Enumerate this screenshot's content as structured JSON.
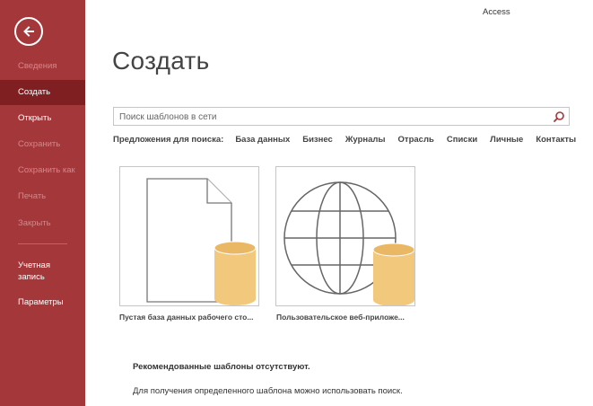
{
  "app": {
    "name": "Access"
  },
  "colors": {
    "sidebar": "#a4373a",
    "sidebar_active": "#7f1f22",
    "db_yellow": "#f2c97c"
  },
  "sidebar": {
    "back_icon": "back-arrow-icon",
    "items": [
      {
        "label": "Сведения",
        "state": "disabled"
      },
      {
        "label": "Создать",
        "state": "active"
      },
      {
        "label": "Открыть",
        "state": "enabled"
      },
      {
        "label": "Сохранить",
        "state": "disabled"
      },
      {
        "label": "Сохранить как",
        "state": "disabled"
      },
      {
        "label": "Печать",
        "state": "disabled"
      },
      {
        "label": "Закрыть",
        "state": "disabled"
      }
    ],
    "bottom_items": [
      {
        "label_line1": "Учетная",
        "label_line2": "запись"
      },
      {
        "label": "Параметры"
      }
    ]
  },
  "main": {
    "title": "Создать",
    "search": {
      "placeholder": "Поиск шаблонов в сети",
      "value": ""
    },
    "suggestions": {
      "label": "Предложения для поиска:",
      "links": [
        "База данных",
        "Бизнес",
        "Журналы",
        "Отрасль",
        "Списки",
        "Личные",
        "Контакты"
      ]
    },
    "templates": [
      {
        "label": "Пустая база данных рабочего сто...",
        "icon": "blank-database-icon"
      },
      {
        "label": "Пользовательское веб-приложе...",
        "icon": "web-app-globe-icon"
      }
    ],
    "no_templates_title": "Рекомендованные шаблоны отсутствуют.",
    "no_templates_hint": "Для получения определенного шаблона можно использовать поиск."
  }
}
